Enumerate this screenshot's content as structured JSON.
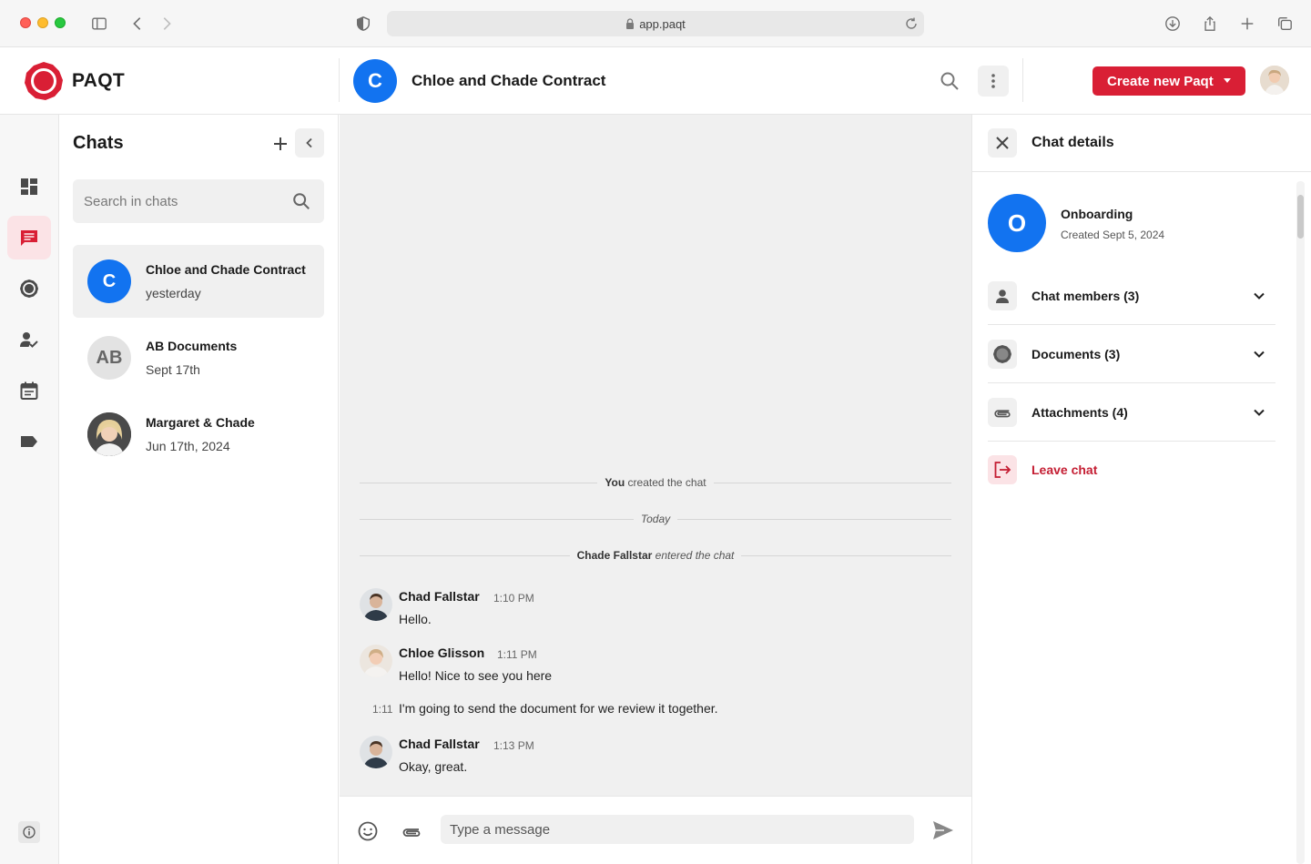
{
  "browser": {
    "url": "app.paqt"
  },
  "header": {
    "brand": "PAQT",
    "chat_avatar_letter": "C",
    "chat_title": "Chloe and Chade Contract",
    "create_button": "Create new Paqt"
  },
  "rail": {
    "items": [
      "dashboard-icon",
      "chat-icon",
      "paqt-icon",
      "user-check-icon",
      "calendar-icon",
      "tag-icon"
    ],
    "active": "chat-icon"
  },
  "chats": {
    "title": "Chats",
    "search_placeholder": "Search in chats",
    "items": [
      {
        "initials": "C",
        "name": "Chloe and Chade Contract",
        "date": "yesterday"
      },
      {
        "initials": "AB",
        "name": "AB Documents",
        "date": "Sept 17th"
      },
      {
        "initials": "",
        "name": "Margaret & Chade",
        "date": "Jun 17th, 2024"
      }
    ]
  },
  "conversation": {
    "system": [
      {
        "bold": "You",
        "text": "created the chat"
      },
      {
        "bold": "",
        "text": "Today"
      },
      {
        "bold": "Chade Fallstar",
        "text": "entered the chat"
      }
    ],
    "messages": [
      {
        "author": "Chad Fallstar",
        "time": "1:10 PM",
        "lines": [
          "Hello."
        ]
      },
      {
        "author": "Chloe Glisson",
        "time": "1:11 PM",
        "lines": [
          "Hello! Nice to see you here"
        ],
        "followup_time": "1:11",
        "followup": "I'm going to send the document for we review it together."
      },
      {
        "author": "Chad Fallstar",
        "time": "1:13 PM",
        "lines": [
          "Okay, great."
        ]
      }
    ]
  },
  "composer": {
    "placeholder": "Type a message"
  },
  "details": {
    "title": "Chat details",
    "group_letter": "O",
    "group_name": "Onboarding",
    "group_created": "Created Sept 5, 2024",
    "sections": [
      {
        "label": "Chat members (3)"
      },
      {
        "label": "Documents (3)"
      },
      {
        "label": "Attachments (4)"
      }
    ],
    "leave": "Leave chat"
  },
  "colors": {
    "brand_red": "#d91f35",
    "avatar_blue": "#1273f0"
  }
}
